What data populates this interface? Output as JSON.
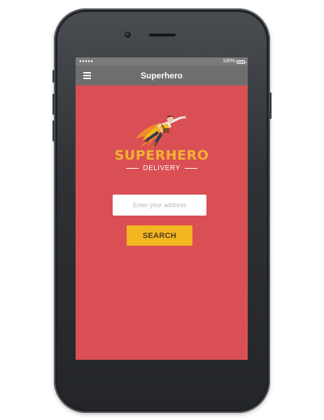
{
  "status_bar": {
    "signal": "●●●●●",
    "battery": "100%"
  },
  "nav": {
    "title": "Superhero",
    "menu_icon": "hamburger-menu-icon"
  },
  "logo": {
    "title": "SUPERHERO",
    "subtitle": "DELIVERY",
    "illustration": "flying-superhero-illustration"
  },
  "search": {
    "placeholder": "Enter your address",
    "value": "",
    "button_label": "SEARCH"
  },
  "colors": {
    "background": "#d94f53",
    "nav_bar": "#6e6e6e",
    "accent": "#f4b620",
    "logo_text": "#f2b233"
  }
}
